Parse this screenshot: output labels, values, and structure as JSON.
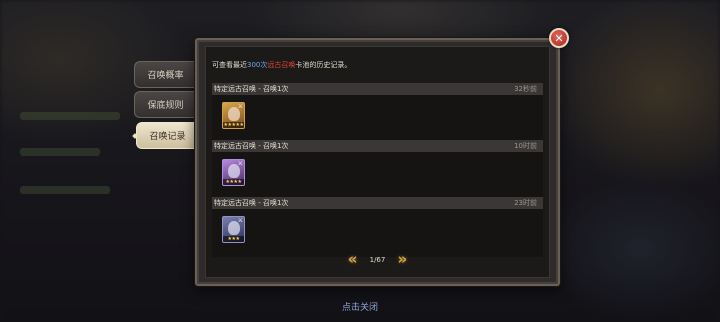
{
  "tabs": [
    {
      "label": "召唤概率",
      "active": false
    },
    {
      "label": "保底规则",
      "active": false
    },
    {
      "label": "召唤记录",
      "active": true
    }
  ],
  "info": {
    "prefix": "可查看最近",
    "count": "300次",
    "pool": "远古召唤",
    "suffix": "卡池的历史记录。"
  },
  "records": [
    {
      "title": "特定远古召唤 - 召唤1次",
      "time": "32秒前",
      "hero_icon": "gold-hero-portrait-icon",
      "stars": "★★★★★"
    },
    {
      "title": "特定远古召唤 - 召唤1次",
      "time": "10时前",
      "hero_icon": "purple-hero-portrait-icon",
      "stars": "★★★★"
    },
    {
      "title": "特定远古召唤 - 召唤1次",
      "time": "23时前",
      "hero_icon": "blue-hero-portrait-icon",
      "stars": "★★★"
    }
  ],
  "pager": {
    "page": "1/67",
    "prev": "«",
    "next": "»"
  },
  "close": {
    "icon": "close-icon",
    "glyph": "✕"
  },
  "tap_close": "点击关闭"
}
